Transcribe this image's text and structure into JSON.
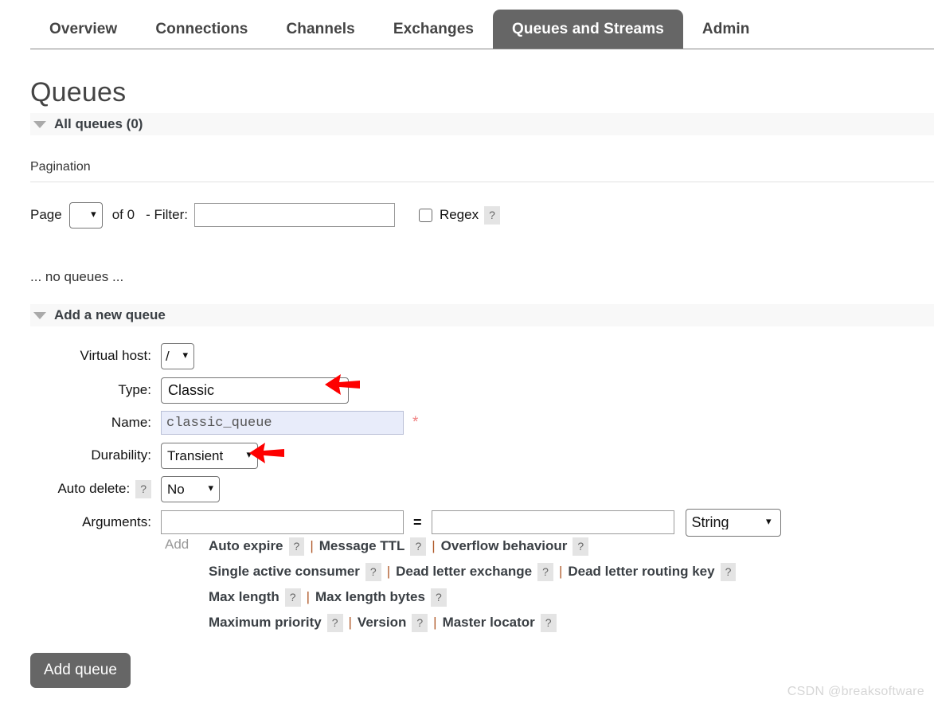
{
  "nav": {
    "tabs": [
      {
        "label": "Overview",
        "active": false
      },
      {
        "label": "Connections",
        "active": false
      },
      {
        "label": "Channels",
        "active": false
      },
      {
        "label": "Exchanges",
        "active": false
      },
      {
        "label": "Queues and Streams",
        "active": true
      },
      {
        "label": "Admin",
        "active": false
      }
    ]
  },
  "page": {
    "title": "Queues",
    "watermark": "CSDN @breaksoftware"
  },
  "all_queues": {
    "header": "All queues (0)",
    "pagination_label": "Pagination",
    "page_label": "Page",
    "page_value": "",
    "of_label": "of 0",
    "filter_label": "- Filter:",
    "filter_value": "",
    "filter_placeholder": "",
    "regex_label": "Regex",
    "regex_help": "?",
    "empty_text": "... no queues ..."
  },
  "add_queue": {
    "header": "Add a new queue",
    "fields": {
      "virtual_host_label": "Virtual host:",
      "virtual_host_value": "/",
      "type_label": "Type:",
      "type_value": "Classic",
      "name_label": "Name:",
      "name_value": "classic_queue",
      "name_required_mark": "*",
      "durability_label": "Durability:",
      "durability_value": "Transient",
      "auto_delete_label": "Auto delete:",
      "auto_delete_help": "?",
      "auto_delete_value": "No",
      "arguments_label": "Arguments:",
      "argument_key_value": "",
      "argument_equals": "=",
      "argument_value_value": "",
      "argument_type_value": "String",
      "add_argument_label": "Add"
    },
    "argument_presets": [
      {
        "label": "Auto expire",
        "help": "?"
      },
      {
        "label": "Message TTL",
        "help": "?"
      },
      {
        "label": "Overflow behaviour",
        "help": "?"
      },
      {
        "label": "Single active consumer",
        "help": "?"
      },
      {
        "label": "Dead letter exchange",
        "help": "?"
      },
      {
        "label": "Dead letter routing key",
        "help": "?"
      },
      {
        "label": "Max length",
        "help": "?"
      },
      {
        "label": "Max length bytes",
        "help": "?"
      },
      {
        "label": "Maximum priority",
        "help": "?"
      },
      {
        "label": "Version",
        "help": "?"
      },
      {
        "label": "Master locator",
        "help": "?"
      }
    ],
    "submit_label": "Add queue"
  },
  "colors": {
    "active_tab_bg": "#666666",
    "section_bar_bg": "#f8f8f8",
    "name_field_bg": "#e8ecfa",
    "annotation_arrow": "#fe0000",
    "required_star": "#f08080"
  }
}
